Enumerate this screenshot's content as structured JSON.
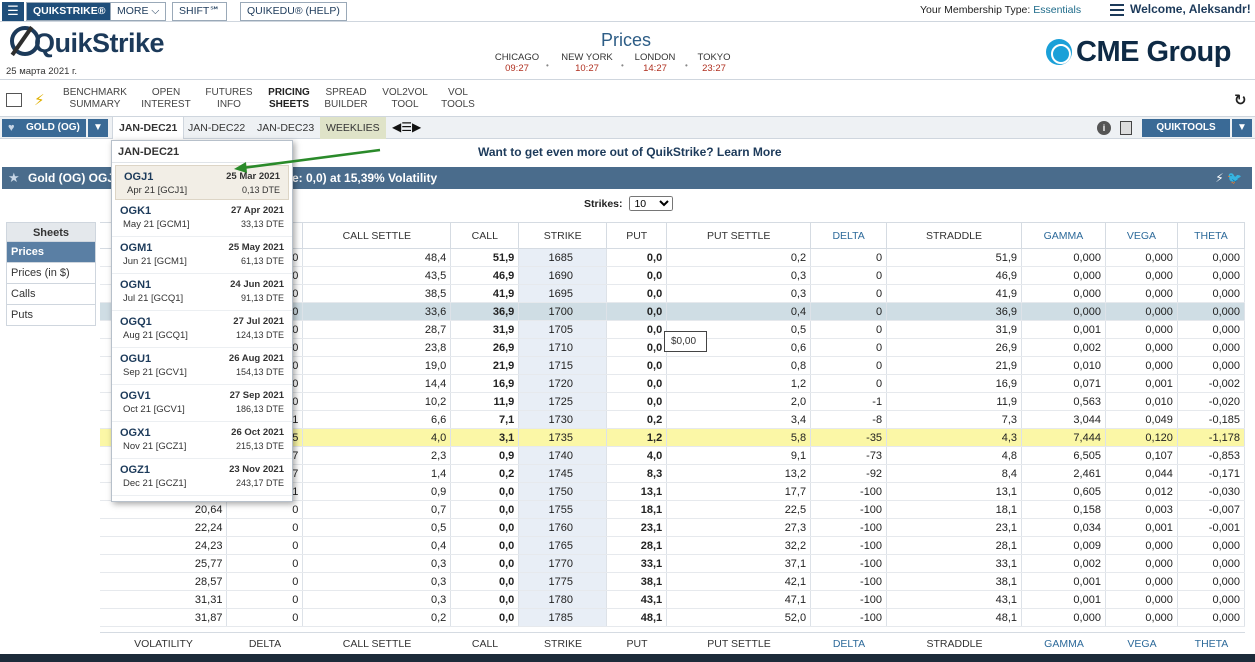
{
  "topbar": {
    "tabs": [
      "QUIKSTRIKE®",
      "MORE",
      "SHIFT℠",
      "QUIKEDU® (HELP)"
    ],
    "membership_label": "Your Membership Type:",
    "membership_value": "Essentials",
    "welcome": "Welcome, Aleksandr!"
  },
  "header": {
    "logo": "QuikStrike",
    "date": "25 марта 2021 г.",
    "title": "Prices",
    "cities": [
      {
        "name": "CHICAGO",
        "time": "09:27"
      },
      {
        "name": "NEW YORK",
        "time": "10:27"
      },
      {
        "name": "LONDON",
        "time": "14:27"
      },
      {
        "name": "TOKYO",
        "time": "23:27"
      }
    ],
    "brand": "CME Group"
  },
  "nav": {
    "items": [
      {
        "l1": "BENCHMARK",
        "l2": "SUMMARY"
      },
      {
        "l1": "OPEN",
        "l2": "INTEREST"
      },
      {
        "l1": "FUTURES",
        "l2": "INFO"
      },
      {
        "l1": "PRICING",
        "l2": "SHEETS"
      },
      {
        "l1": "SPREAD",
        "l2": "BUILDER"
      },
      {
        "l1": "VOL2VOL",
        "l2": "TOOL"
      },
      {
        "l1": "VOL",
        "l2": "TOOLS"
      }
    ]
  },
  "subbar": {
    "product": "GOLD (OG)",
    "tabs": [
      "JAN-DEC21",
      "JAN-DEC22",
      "JAN-DEC23",
      "WEEKLIES"
    ],
    "quiktools": "QUIKTOOLS"
  },
  "promo": {
    "text": "Want to get even more out of QuikStrike?",
    "link": "Learn More"
  },
  "titlebar": {
    "left": "Gold (OG) OGJ",
    "right": "e: 0,0) at 15,39% Volatility"
  },
  "strikes": {
    "label": "Strikes:",
    "value": "10"
  },
  "side": {
    "header": "Sheets",
    "items": [
      "Prices",
      "Prices (in $)",
      "Calls",
      "Puts"
    ]
  },
  "columns": [
    "VOLATILITY",
    "DELTA",
    "CALL SETTLE",
    "CALL",
    "STRIKE",
    "PUT",
    "PUT SETTLE",
    "DELTA",
    "STRADDLE",
    "GAMMA",
    "VEGA",
    "THETA"
  ],
  "rows": [
    [
      "",
      "0",
      "48,4",
      "51,9",
      "1685",
      "0,0",
      "0,2",
      "0",
      "51,9",
      "0,000",
      "0,000",
      "0,000"
    ],
    [
      "",
      "0",
      "43,5",
      "46,9",
      "1690",
      "0,0",
      "0,3",
      "0",
      "46,9",
      "0,000",
      "0,000",
      "0,000"
    ],
    [
      "",
      "0",
      "38,5",
      "41,9",
      "1695",
      "0,0",
      "0,3",
      "0",
      "41,9",
      "0,000",
      "0,000",
      "0,000"
    ],
    [
      "",
      "0",
      "33,6",
      "36,9",
      "1700",
      "0,0",
      "0,4",
      "0",
      "36,9",
      "0,000",
      "0,000",
      "0,000"
    ],
    [
      "",
      "0",
      "28,7",
      "31,9",
      "1705",
      "0,0",
      "0,5",
      "0",
      "31,9",
      "0,001",
      "0,000",
      "0,000"
    ],
    [
      "",
      "0",
      "23,8",
      "26,9",
      "1710",
      "0,0",
      "0,6",
      "0",
      "26,9",
      "0,002",
      "0,000",
      "0,000"
    ],
    [
      "",
      "0",
      "19,0",
      "21,9",
      "1715",
      "0,0",
      "0,8",
      "0",
      "21,9",
      "0,010",
      "0,000",
      "0,000"
    ],
    [
      "",
      "0",
      "14,4",
      "16,9",
      "1720",
      "0,0",
      "1,2",
      "0",
      "16,9",
      "0,071",
      "0,001",
      "-0,002"
    ],
    [
      "",
      "0",
      "10,2",
      "11,9",
      "1725",
      "0,0",
      "2,0",
      "-1",
      "11,9",
      "0,563",
      "0,010",
      "-0,020"
    ],
    [
      "",
      "1",
      "6,6",
      "7,1",
      "1730",
      "0,2",
      "3,4",
      "-8",
      "7,3",
      "3,044",
      "0,049",
      "-0,185"
    ],
    [
      "",
      "5",
      "4,0",
      "3,1",
      "1735",
      "1,2",
      "5,8",
      "-35",
      "4,3",
      "7,444",
      "0,120",
      "-1,178"
    ],
    [
      "",
      "7",
      "2,3",
      "0,9",
      "1740",
      "4,0",
      "9,1",
      "-73",
      "4,8",
      "6,505",
      "0,107",
      "-0,853"
    ],
    [
      "",
      "7",
      "1,4",
      "0,2",
      "1745",
      "8,3",
      "13,2",
      "-92",
      "8,4",
      "2,461",
      "0,044",
      "-0,171"
    ],
    [
      "",
      "1",
      "0,9",
      "0,0",
      "1750",
      "13,1",
      "17,7",
      "-100",
      "13,1",
      "0,605",
      "0,012",
      "-0,030"
    ],
    [
      "20,64",
      "0",
      "0,7",
      "0,0",
      "1755",
      "18,1",
      "22,5",
      "-100",
      "18,1",
      "0,158",
      "0,003",
      "-0,007"
    ],
    [
      "22,24",
      "0",
      "0,5",
      "0,0",
      "1760",
      "23,1",
      "27,3",
      "-100",
      "23,1",
      "0,034",
      "0,001",
      "-0,001"
    ],
    [
      "24,23",
      "0",
      "0,4",
      "0,0",
      "1765",
      "28,1",
      "32,2",
      "-100",
      "28,1",
      "0,009",
      "0,000",
      "0,000"
    ],
    [
      "25,77",
      "0",
      "0,3",
      "0,0",
      "1770",
      "33,1",
      "37,1",
      "-100",
      "33,1",
      "0,002",
      "0,000",
      "0,000"
    ],
    [
      "28,57",
      "0",
      "0,3",
      "0,0",
      "1775",
      "38,1",
      "42,1",
      "-100",
      "38,1",
      "0,001",
      "0,000",
      "0,000"
    ],
    [
      "31,31",
      "0",
      "0,3",
      "0,0",
      "1780",
      "43,1",
      "47,1",
      "-100",
      "43,1",
      "0,001",
      "0,000",
      "0,000"
    ],
    [
      "31,87",
      "0",
      "0,2",
      "0,0",
      "1785",
      "48,1",
      "52,0",
      "-100",
      "48,1",
      "0,000",
      "0,000",
      "0,000"
    ]
  ],
  "tooltip": "$0,00",
  "dropdown": {
    "header": "JAN-DEC21",
    "items": [
      {
        "sym": "OGJ1",
        "sub": "Apr 21  [GCJ1]",
        "exp": "25 Mar 2021",
        "dte": "0,13 DTE"
      },
      {
        "sym": "OGK1",
        "sub": "May 21  [GCM1]",
        "exp": "27 Apr 2021",
        "dte": "33,13 DTE"
      },
      {
        "sym": "OGM1",
        "sub": "Jun 21  [GCM1]",
        "exp": "25 May 2021",
        "dte": "61,13 DTE"
      },
      {
        "sym": "OGN1",
        "sub": "Jul 21  [GCQ1]",
        "exp": "24 Jun 2021",
        "dte": "91,13 DTE"
      },
      {
        "sym": "OGQ1",
        "sub": "Aug 21  [GCQ1]",
        "exp": "27 Jul 2021",
        "dte": "124,13 DTE"
      },
      {
        "sym": "OGU1",
        "sub": "Sep 21  [GCV1]",
        "exp": "26 Aug 2021",
        "dte": "154,13 DTE"
      },
      {
        "sym": "OGV1",
        "sub": "Oct 21  [GCV1]",
        "exp": "27 Sep 2021",
        "dte": "186,13 DTE"
      },
      {
        "sym": "OGX1",
        "sub": "Nov 21  [GCZ1]",
        "exp": "26 Oct 2021",
        "dte": "215,13 DTE"
      },
      {
        "sym": "OGZ1",
        "sub": "Dec 21  [GCZ1]",
        "exp": "23 Nov 2021",
        "dte": "243,17 DTE"
      }
    ]
  },
  "colors": {
    "accent": "#3a6a96",
    "highlight": "#fbf7a6",
    "atm": "#cfdde4"
  }
}
